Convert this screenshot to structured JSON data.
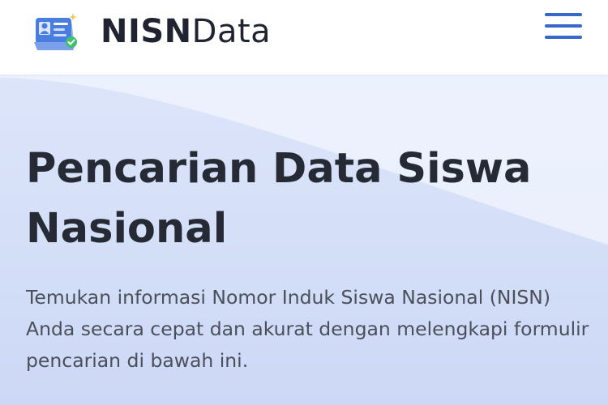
{
  "header": {
    "brand_bold": "NISN",
    "brand_light": "Data",
    "logo_icon": "student-id-card-icon",
    "menu_icon": "hamburger-menu-icon"
  },
  "hero": {
    "title": "Pencarian Data Siswa Nasional",
    "description": "Temukan informasi Nomor Induk Siswa Nasional (NISN) Anda secara cepat dan akurat dengan melengkapi formulir pencarian di bawah ini."
  },
  "colors": {
    "brand_text": "#1f2430",
    "menu_accent": "#3568c9",
    "hero_bg_light": "#e6edfb",
    "hero_bg_dark": "#cdd9f6"
  }
}
